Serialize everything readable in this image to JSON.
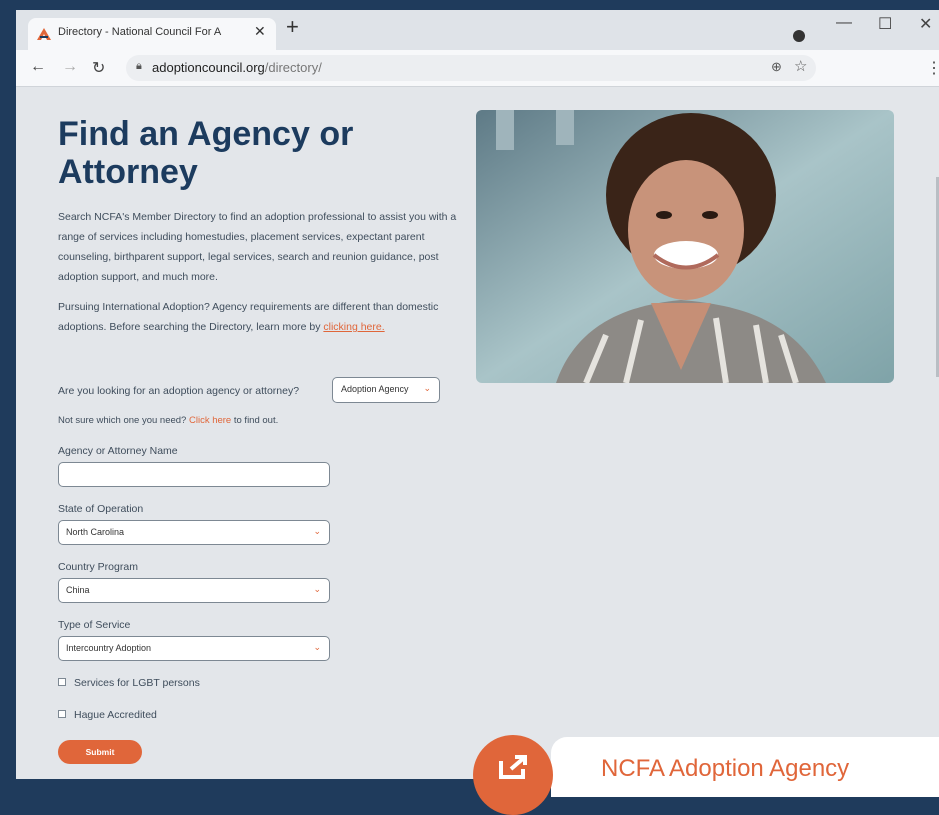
{
  "browser": {
    "tab_title": "Directory - National Council For A",
    "close_symbol": "✕",
    "new_tab_symbol": "+",
    "url_domain": "adoptioncouncil.org",
    "url_path": "/directory/"
  },
  "page": {
    "title": "Find an Agency or Attorney",
    "intro": "Search NCFA's Member Directory to find an adoption professional to assist you with a range of services including homestudies, placement services, expectant parent counseling, birthparent support, legal services, search and reunion guidance, post adoption support, and much more.",
    "intl_text": "Pursuing International Adoption? Agency requirements are different than domestic adoptions. Before searching the Directory, learn more by",
    "intl_link": "clicking here.",
    "question": "Are you looking for an adoption agency or attorney?",
    "agency_type_value": "Adoption Agency",
    "hint_text": "Not sure which one you need?",
    "hint_link": "Click here",
    "hint_suffix": "to find out.",
    "fields": {
      "name_label": "Agency or Attorney Name",
      "name_value": "",
      "state_label": "State of Operation",
      "state_value": "North Carolina",
      "country_label": "Country Program",
      "country_value": "China",
      "service_label": "Type of Service",
      "service_value": "Intercountry Adoption"
    },
    "checkboxes": {
      "lgbt": "Services for LGBT persons",
      "hague": "Hague Accredited"
    },
    "submit_label": "Submit",
    "popup_text": "NCFA Adoption Agency"
  },
  "colors": {
    "accent": "#e0663a",
    "heading": "#1c3b5e",
    "background": "#e3e6ea"
  }
}
